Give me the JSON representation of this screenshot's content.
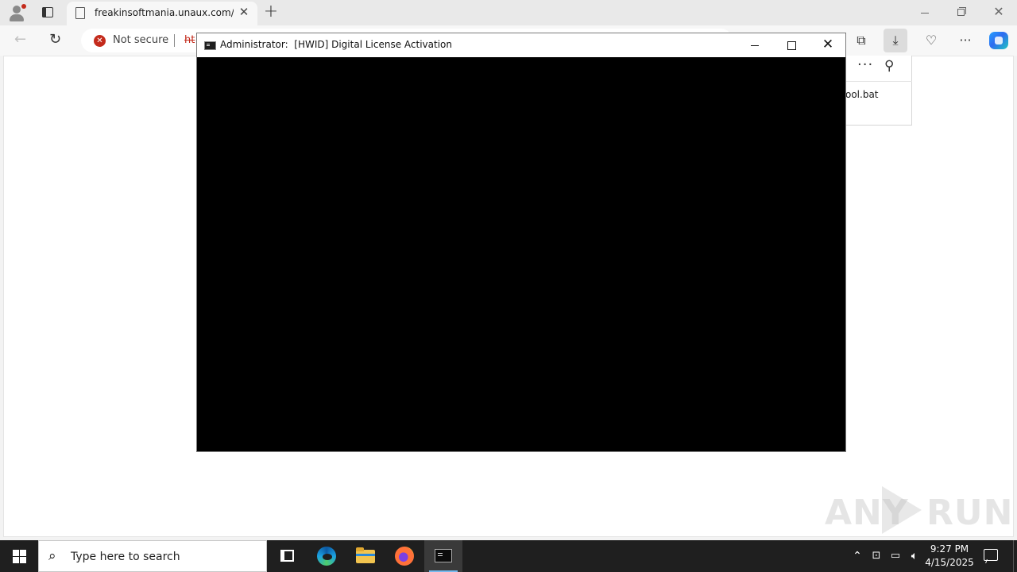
{
  "browser": {
    "tab": {
      "title": "freakinsoftmania.unaux.com/pro"
    },
    "address": {
      "security_label": "Not secure",
      "url_visible": "ht"
    },
    "downloads_panel": {
      "file_name": "ool.bat"
    }
  },
  "console": {
    "title": "Administrator:  [HWID] Digital License Activation"
  },
  "taskbar": {
    "search_placeholder": "Type here to search",
    "time": "9:27 PM",
    "date": "4/15/2025"
  },
  "watermark": {
    "left": "ANY",
    "right": "RUN"
  },
  "colors": {
    "console_bg": "#000000",
    "taskbar_bg": "#1f1f1f",
    "not_secure": "#c42b1c",
    "active_indicator": "#76b9ed"
  },
  "icons": [
    "profile-icon",
    "tab-actions-icon",
    "page-icon",
    "close-icon",
    "new-tab-icon",
    "back-icon",
    "refresh-icon",
    "warning-icon",
    "collections-icon",
    "download-icon",
    "browser-essentials-icon",
    "more-icon",
    "copilot-icon",
    "pin-icon",
    "cmd-icon",
    "windows-start-icon",
    "search-icon",
    "task-view-icon",
    "edge-icon",
    "file-explorer-icon",
    "firefox-icon",
    "chevron-up-icon",
    "network-icon",
    "volume-icon",
    "notifications-icon"
  ]
}
